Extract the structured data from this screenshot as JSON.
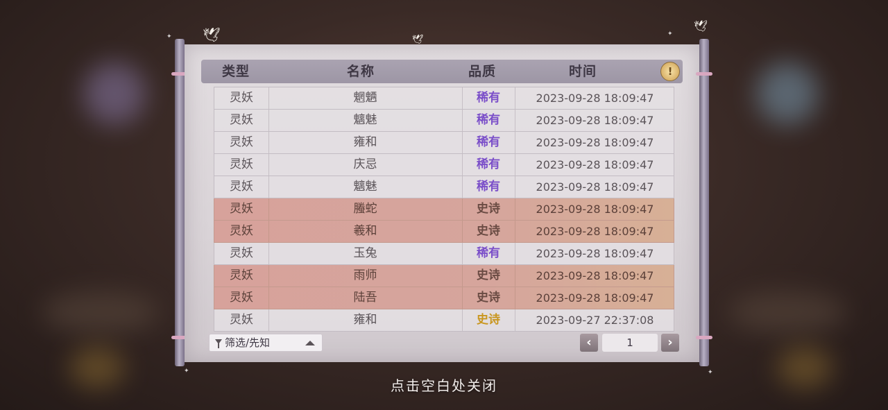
{
  "header": {
    "columns": [
      "类型",
      "名称",
      "品质",
      "时间"
    ],
    "hint_icon": "lightbulb-icon"
  },
  "rows": [
    {
      "type": "灵妖",
      "name": "魍魉",
      "quality": "稀有",
      "quality_class": "rare",
      "time": "2023-09-28  18:09:47"
    },
    {
      "type": "灵妖",
      "name": "魑魅",
      "quality": "稀有",
      "quality_class": "rare",
      "time": "2023-09-28  18:09:47"
    },
    {
      "type": "灵妖",
      "name": "雍和",
      "quality": "稀有",
      "quality_class": "rare",
      "time": "2023-09-28  18:09:47"
    },
    {
      "type": "灵妖",
      "name": "庆忌",
      "quality": "稀有",
      "quality_class": "rare",
      "time": "2023-09-28  18:09:47"
    },
    {
      "type": "灵妖",
      "name": "魑魅",
      "quality": "稀有",
      "quality_class": "rare",
      "time": "2023-09-28  18:09:47"
    },
    {
      "type": "灵妖",
      "name": "螣蛇",
      "quality": "史诗",
      "quality_class": "epic",
      "time": "2023-09-28  18:09:47"
    },
    {
      "type": "灵妖",
      "name": "羲和",
      "quality": "史诗",
      "quality_class": "epic",
      "time": "2023-09-28  18:09:47"
    },
    {
      "type": "灵妖",
      "name": "玉兔",
      "quality": "稀有",
      "quality_class": "rare",
      "time": "2023-09-28  18:09:47"
    },
    {
      "type": "灵妖",
      "name": "雨师",
      "quality": "史诗",
      "quality_class": "epic",
      "time": "2023-09-28  18:09:47"
    },
    {
      "type": "灵妖",
      "name": "陆吾",
      "quality": "史诗",
      "quality_class": "epic",
      "time": "2023-09-28  18:09:47"
    },
    {
      "type": "灵妖",
      "name": "雍和",
      "quality": "史诗",
      "quality_class": "epic-gold",
      "time": "2023-09-27  22:37:08"
    }
  ],
  "filter": {
    "label": "筛选/先知"
  },
  "pagination": {
    "prev": "‹",
    "next": "›",
    "page": "1"
  },
  "close_hint": "点击空白处关闭",
  "colors": {
    "rare": "#7b4fc9",
    "epic_row": "#d7a29b",
    "epic_gold_text": "#c9961f"
  }
}
